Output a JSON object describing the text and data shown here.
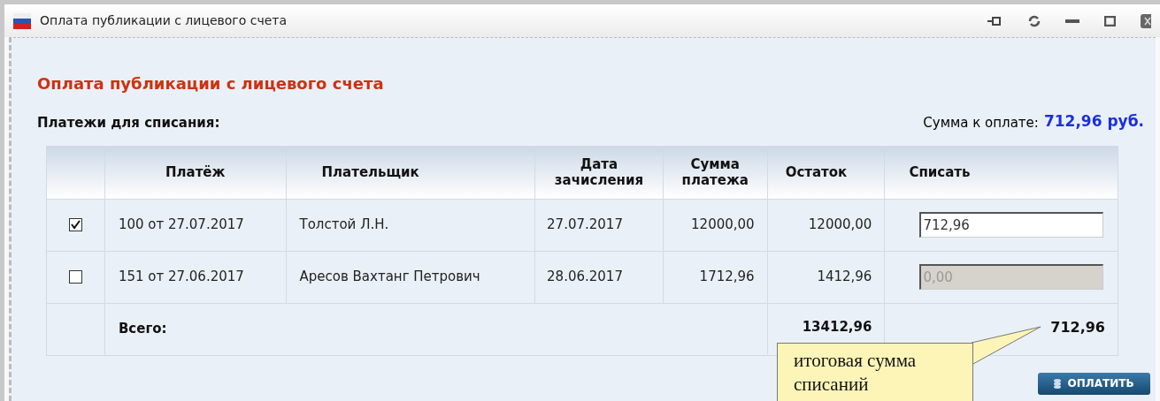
{
  "window": {
    "title": "Оплата публикации с лицевого счета"
  },
  "heading": "Оплата публикации с лицевого счета",
  "section_label": "Платежи для списания:",
  "amount_due": {
    "label": "Сумма к оплате:",
    "value": "712,96 руб."
  },
  "table": {
    "columns": [
      "",
      "Платёж",
      "Плательщик",
      "Дата зачисления",
      "Сумма платежа",
      "Остаток",
      "Списать"
    ],
    "rows": [
      {
        "checked": true,
        "payment": "100 от 27.07.2017",
        "payer": "Толстой Л.Н.",
        "date": "27.07.2017",
        "sum": "12000,00",
        "balance": "12000,00",
        "writeoff": "712,96",
        "disabled": false
      },
      {
        "checked": false,
        "payment": "151 от 27.06.2017",
        "payer": "Аресов Вахтанг Петрович",
        "date": "28.06.2017",
        "sum": "1712,96",
        "balance": "1412,96",
        "writeoff": "0,00",
        "disabled": true
      }
    ],
    "total": {
      "label": "Всего:",
      "balance": "13412,96",
      "writeoff": "712,96"
    }
  },
  "callout": "итоговая сумма списаний",
  "pay_button": "ОПЛАТИТЬ"
}
